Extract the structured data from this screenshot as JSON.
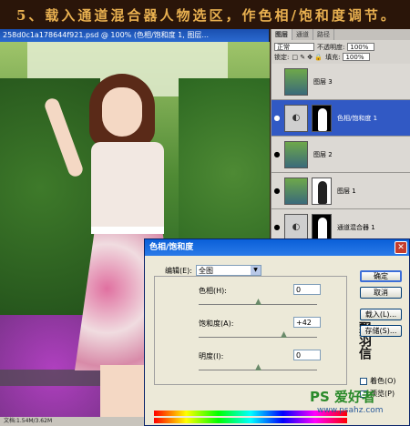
{
  "banner": {
    "text": "5、载入通道混合器人物选区，作色相/饱和度调节。"
  },
  "document": {
    "title": "258d0c1a178644f921.psd @ 100% (色相/饱和度 1, 图层...",
    "status": "文档:1.54M/3.62M"
  },
  "layers_panel": {
    "tabs": [
      "图层",
      "通道",
      "路径"
    ],
    "blend_mode": "正常",
    "opacity_label": "不透明度:",
    "opacity_value": "100%",
    "lock_label": "锁定:",
    "fill_label": "填充:",
    "fill_value": "100%",
    "layers": [
      {
        "name": "图层 3",
        "visible": false,
        "selected": false
      },
      {
        "name": "色相/饱和度 1",
        "visible": true,
        "selected": true
      },
      {
        "name": "图层 2",
        "visible": true,
        "selected": false
      },
      {
        "name": "图层 1",
        "visible": true,
        "selected": false
      },
      {
        "name": "通道混合器 1",
        "visible": true,
        "selected": false
      }
    ]
  },
  "dialog": {
    "title": "色相/饱和度",
    "edit_label": "编辑(E):",
    "edit_value": "全图",
    "hue_label": "色相(H):",
    "hue_value": "0",
    "saturation_label": "饱和度(A):",
    "saturation_value": "+42",
    "lightness_label": "明度(I):",
    "lightness_value": "0",
    "ok": "确定",
    "cancel": "取消",
    "load": "载入(L)...",
    "save": "存储(S)...",
    "colorize": "着色(O)",
    "preview": "预览(P)"
  },
  "watermark": {
    "text": "PS 爱好者",
    "url": "www.psahz.com"
  },
  "colors": {
    "accent": "#3159c4",
    "title_bar": "#0a5fd8",
    "banner_text": "#e8b050"
  }
}
